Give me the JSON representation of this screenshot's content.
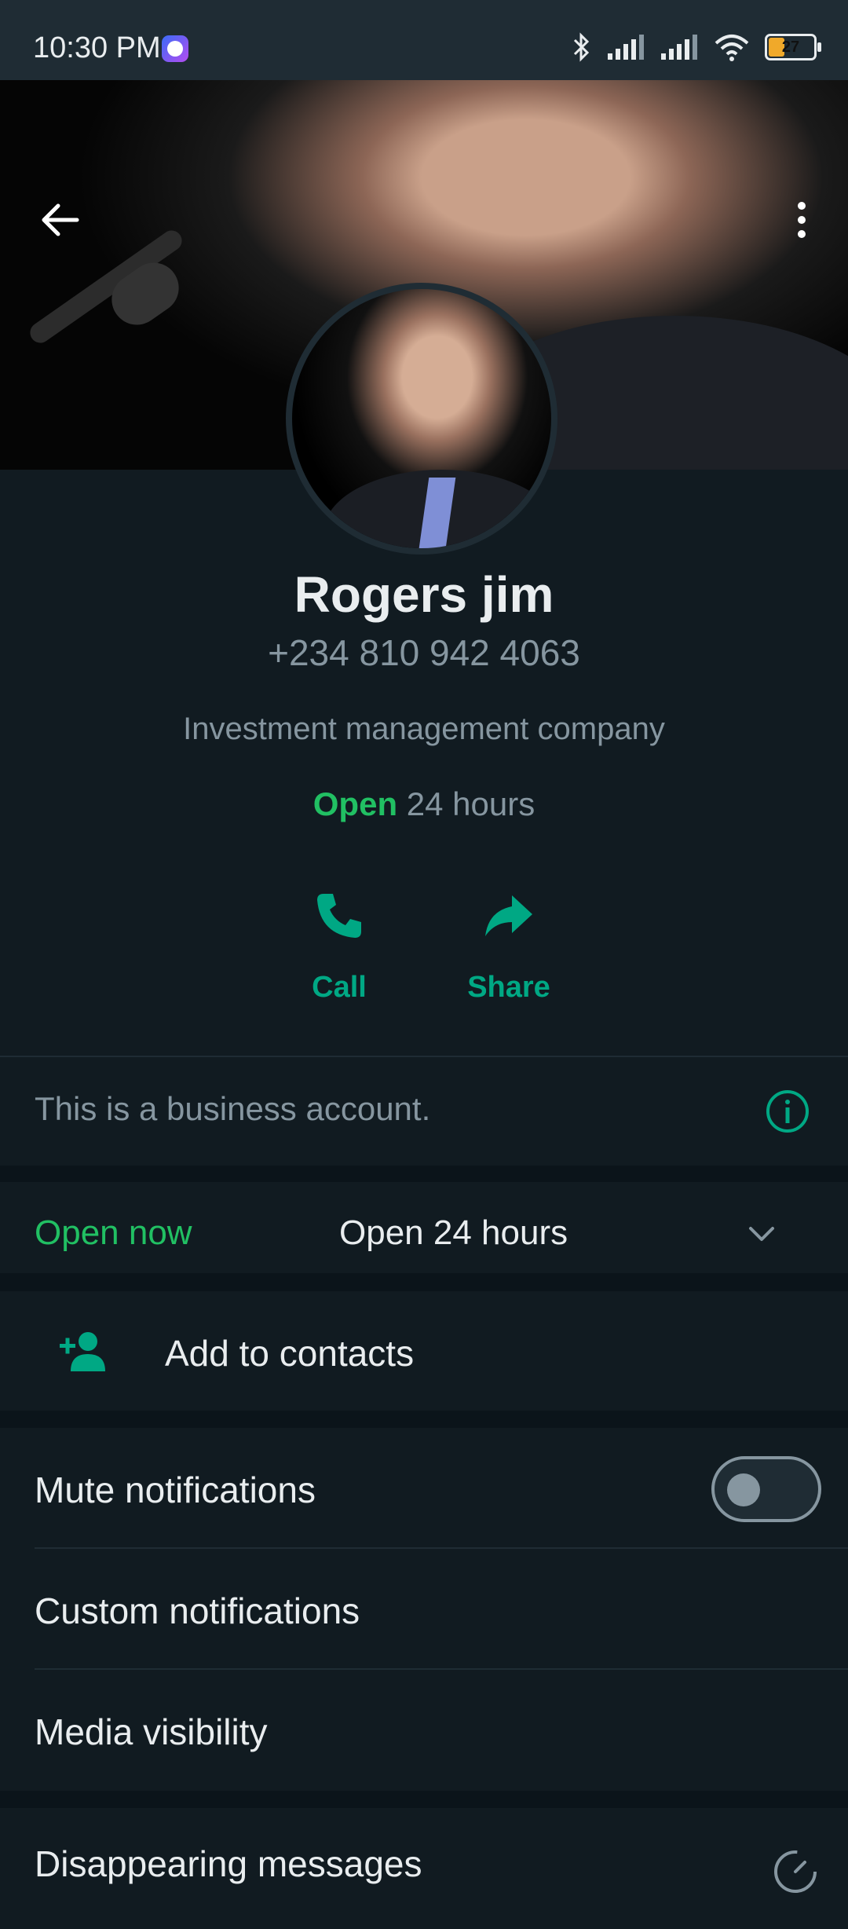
{
  "status_bar": {
    "time": "10:30 PM",
    "battery": "27",
    "icons": [
      "messenger-icon",
      "bluetooth-icon",
      "signal-icon",
      "signal-icon",
      "wifi-icon",
      "battery-icon"
    ]
  },
  "header": {
    "back_icon": "arrow-left-icon",
    "menu_icon": "more-vertical-icon"
  },
  "profile": {
    "name": "Rogers jim",
    "phone": "+234 810 942 4063",
    "description": "Investment management company",
    "hours_status": "Open",
    "hours_text": "24 hours"
  },
  "actions": [
    {
      "label": "Call",
      "icon": "phone-icon"
    },
    {
      "label": "Share",
      "icon": "share-icon"
    }
  ],
  "business_notice": {
    "text": "This is a business account.",
    "icon": "info-icon"
  },
  "business_hours": {
    "status": "Open now",
    "value": "Open 24 hours",
    "icon": "chevron-down-icon"
  },
  "add_contact": {
    "label": "Add to contacts",
    "icon": "person-add-icon"
  },
  "settings": [
    {
      "label": "Mute notifications",
      "toggle": false
    },
    {
      "label": "Custom notifications"
    },
    {
      "label": "Media visibility"
    },
    {
      "label": "Disappearing messages",
      "icon": "timer-icon"
    }
  ],
  "colors": {
    "accent": "#00a884",
    "open_green": "#21c063",
    "background": "#111b21",
    "secondary_text": "#8696a0"
  }
}
